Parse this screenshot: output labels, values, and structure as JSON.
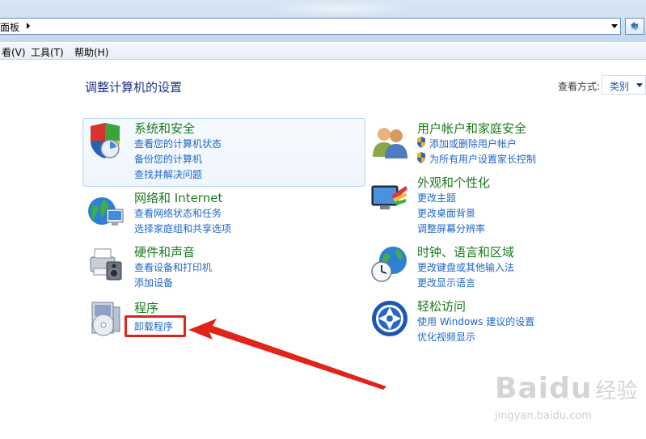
{
  "window": {
    "address_text": "面板",
    "menu": [
      "看(V)",
      "工具(T)",
      "帮助(H)"
    ]
  },
  "header": {
    "page_title": "调整计算机的设置",
    "view_label": "查看方式:",
    "view_value": "类别"
  },
  "categories": [
    {
      "title": "系统和安全",
      "icon": "system-security-icon",
      "links": [
        "查看您的计算机状态",
        "备份您的计算机",
        "查找并解决问题"
      ]
    },
    {
      "title": "网络和 Internet",
      "icon": "network-internet-icon",
      "links": [
        "查看网络状态和任务",
        "选择家庭组和共享选项"
      ]
    },
    {
      "title": "硬件和声音",
      "icon": "hardware-sound-icon",
      "links": [
        "查看设备和打印机",
        "添加设备"
      ]
    },
    {
      "title": "程序",
      "icon": "programs-icon",
      "links": [
        "卸载程序"
      ]
    },
    {
      "title": "用户帐户和家庭安全",
      "icon": "user-accounts-icon",
      "links": [
        "添加或删除用户帐户",
        "为所有用户设置家长控制"
      ]
    },
    {
      "title": "外观和个性化",
      "icon": "appearance-icon",
      "links": [
        "更改主题",
        "更改桌面背景",
        "调整屏幕分辨率"
      ]
    },
    {
      "title": "时钟、语言和区域",
      "icon": "clock-region-icon",
      "links": [
        "更改键盘或其他输入法",
        "更改显示语言"
      ]
    },
    {
      "title": "轻松访问",
      "icon": "ease-of-access-icon",
      "links": [
        "使用 Windows 建议的设置",
        "优化视频显示"
      ]
    }
  ],
  "annotation": {
    "highlight_color": "#e2231a"
  },
  "watermark": {
    "brand": "Baidu",
    "cn": "经验",
    "url": "jingyan.baidu.com"
  },
  "colors": {
    "title_green": "#1b7a1e",
    "link_blue": "#1f66c7",
    "heading_navy": "#1e3287"
  }
}
